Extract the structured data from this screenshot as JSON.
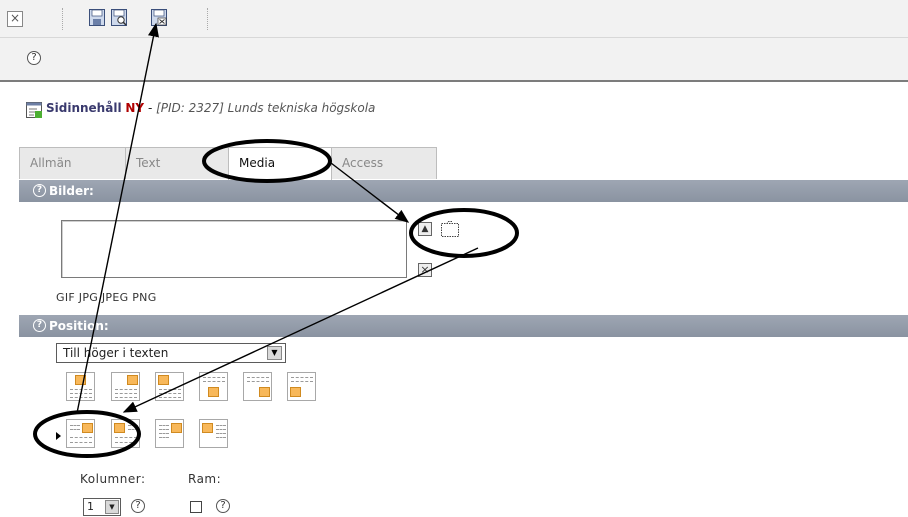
{
  "toolbar": {
    "close": "×",
    "icons": [
      "save-icon",
      "save-and-view-icon",
      "save-and-close-icon"
    ]
  },
  "help": "?",
  "header": {
    "page_type": "Sidinnehåll",
    "new_badge": "NY",
    "separator": " - ",
    "page_info": "[PID: 2327] Lunds tekniska högskola"
  },
  "tabs": [
    {
      "label": "Allmän",
      "active": false
    },
    {
      "label": "Text",
      "active": false
    },
    {
      "label": "Media",
      "active": true
    },
    {
      "label": "Access",
      "active": false
    }
  ],
  "images": {
    "title": "Bilder:",
    "allowed_types": "GIF JPG JPEG PNG",
    "move_up": "▲",
    "remove": "×"
  },
  "position": {
    "title": "Position:",
    "selected": "Till höger i texten",
    "dropdown_arrow": "▼"
  },
  "columns": {
    "label": "Kolumner:",
    "value": "1",
    "dropdown_arrow": "▼"
  },
  "frame": {
    "label": "Ram:",
    "checked": false
  },
  "colors": {
    "section_bar": "#959daa",
    "annotation": "#000000",
    "image_placeholder": "#f8b85a"
  }
}
